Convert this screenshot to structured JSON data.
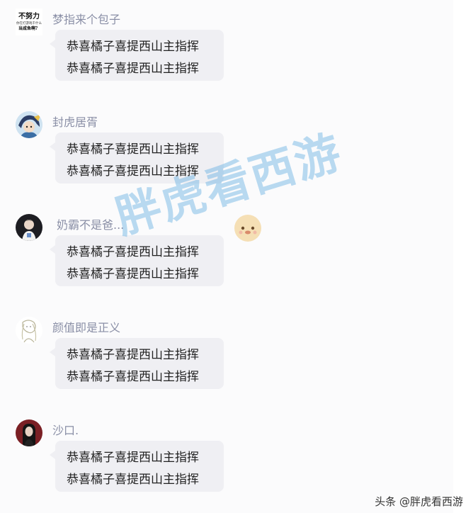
{
  "messages": [
    {
      "user": "梦指来个包子",
      "avatar_icon": "not-trying-logo",
      "avatar_text": [
        "不努力",
        "你在打游戏干什么",
        "当咸鱼啊？"
      ],
      "lines": [
        "恭喜橘子喜提西山主指挥",
        "恭喜橘子喜提西山主指挥"
      ]
    },
    {
      "user": "封虎居胥",
      "avatar_icon": "anime-character-avatar",
      "lines": [
        "恭喜橘子喜提西山主指挥",
        "恭喜橘子喜提西山主指挥"
      ]
    },
    {
      "user": "奶霸不是爸...",
      "avatar_icon": "dark-character-avatar",
      "lines": [
        "恭喜橘子喜提西山主指挥",
        "恭喜橘子喜提西山主指挥"
      ]
    },
    {
      "user": "颜值即是正义",
      "avatar_icon": "sketch-character-avatar",
      "lines": [
        "恭喜橘子喜提西山主指挥",
        "恭喜橘子喜提西山主指挥"
      ]
    },
    {
      "user": "沙口.",
      "avatar_icon": "red-portrait-avatar",
      "lines": [
        "恭喜橘子喜提西山主指挥",
        "恭喜橘子喜提西山主指挥"
      ]
    }
  ],
  "watermark": {
    "text": "胖虎看西游",
    "icon": "cartoon-face-icon",
    "color": "#5aaae1"
  },
  "footer": {
    "text": "头条 @胖虎看西游"
  }
}
